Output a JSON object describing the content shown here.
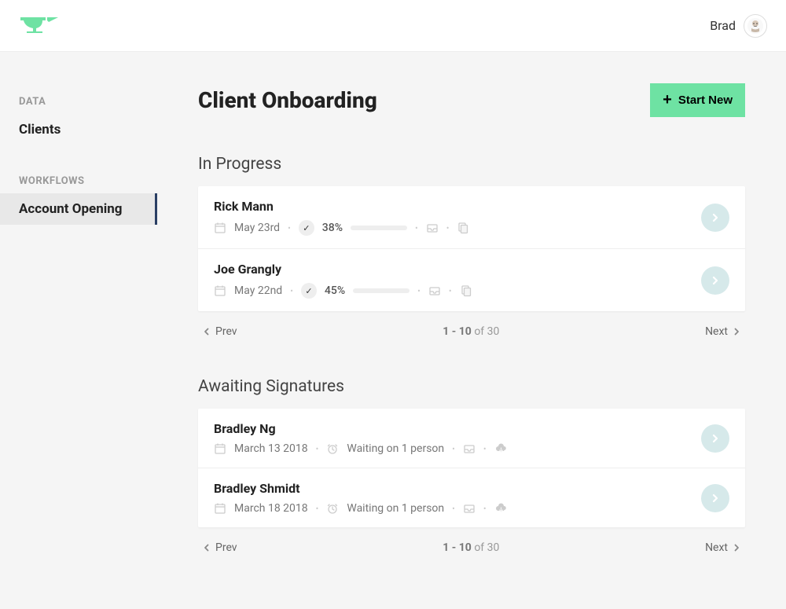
{
  "header": {
    "user_name": "Brad"
  },
  "sidebar": {
    "groups": [
      {
        "heading": "DATA",
        "items": [
          {
            "label": "Clients",
            "active": false
          }
        ]
      },
      {
        "heading": "WORKFLOWS",
        "items": [
          {
            "label": "Account Opening",
            "active": true
          }
        ]
      }
    ]
  },
  "page": {
    "title": "Client Onboarding",
    "start_new_label": "Start New"
  },
  "sections": {
    "in_progress": {
      "title": "In Progress",
      "rows": [
        {
          "name": "Rick Mann",
          "date": "May 23rd",
          "percent": "38%",
          "progress": 38
        },
        {
          "name": "Joe Grangly",
          "date": "May 22nd",
          "percent": "45%",
          "progress": 45
        }
      ],
      "pager": {
        "prev": "Prev",
        "next": "Next",
        "range": "1 - 10",
        "of": "of 30"
      }
    },
    "awaiting": {
      "title": "Awaiting Signatures",
      "rows": [
        {
          "name": "Bradley Ng",
          "date": "March 13 2018",
          "status": "Waiting on 1 person"
        },
        {
          "name": "Bradley Shmidt",
          "date": "March 18 2018",
          "status": "Waiting on 1 person"
        }
      ],
      "pager": {
        "prev": "Prev",
        "next": "Next",
        "range": "1 - 10",
        "of": "of 30"
      }
    }
  }
}
